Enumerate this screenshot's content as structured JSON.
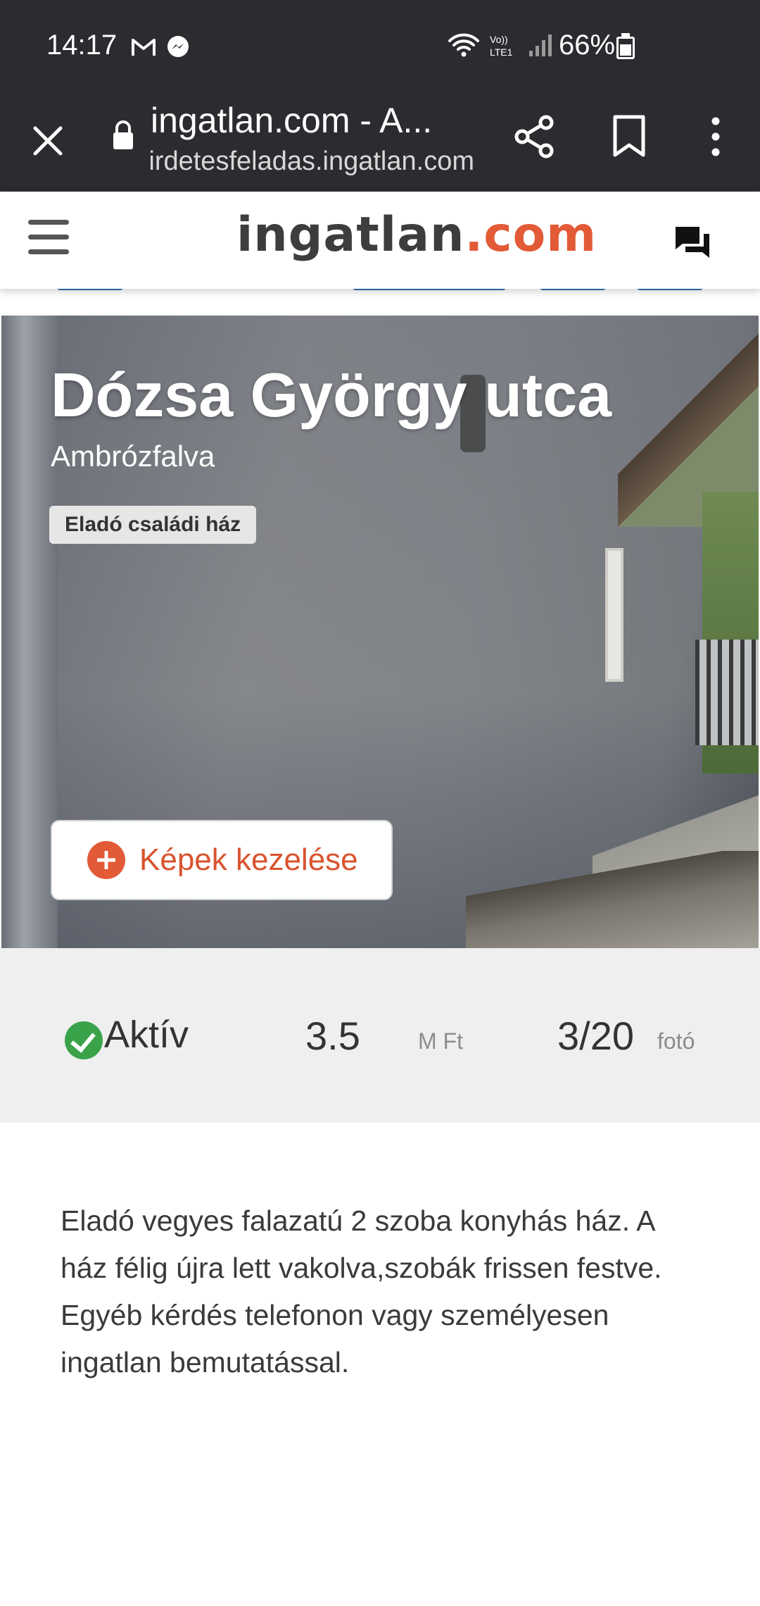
{
  "status_bar": {
    "time": "14:17",
    "battery": "66%",
    "icons": [
      "gmail-icon",
      "messenger-icon",
      "wifi-icon",
      "volte-icon",
      "signal-icon",
      "battery-icon"
    ]
  },
  "browser": {
    "page_title": "ingatlan.com - A...",
    "url_host": "hirdetesfeladas.ingatlan.com",
    "icons": [
      "close-icon",
      "lock-icon",
      "share-icon",
      "bookmark-icon",
      "more-vert-icon"
    ]
  },
  "site": {
    "logo_part1": "ingatlan",
    "logo_part2": ".com",
    "icons": [
      "hamburger-icon",
      "chat-icon"
    ]
  },
  "listing": {
    "title": "Dózsa György utca",
    "city": "Ambrózfalva",
    "badge": "Eladó családi ház",
    "manage_photos_label": "Képek kezelése",
    "status": "Aktív",
    "price": "3.5",
    "price_unit": "M Ft",
    "photo_count": "3/20",
    "photo_unit": "fotó",
    "description": "Eladó vegyes falazatú 2 szoba konyhás ház. A ház félig újra lett vakolva,szobák frissen festve. Egyéb kérdés telefonon vagy személyesen ingatlan bemutatással."
  },
  "colors": {
    "accent": "#e25a36",
    "status_green": "#3aa34a",
    "chrome_dark": "#2b2c2f"
  }
}
